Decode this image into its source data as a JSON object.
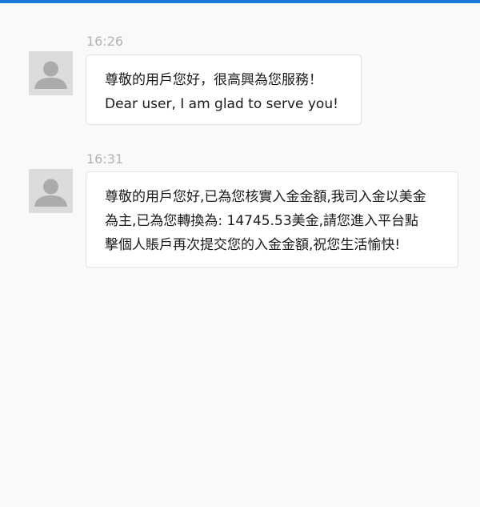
{
  "accent_color": "#1a7bd6",
  "messages": [
    {
      "time": "16:26",
      "avatar_icon": "user-silhouette-icon",
      "lines": [
        "尊敬的用戶您好，很高興為您服務！",
        "Dear user, I am glad to serve you!"
      ]
    },
    {
      "time": "16:31",
      "avatar_icon": "user-silhouette-icon",
      "lines": [
        "尊敬的用戶您好,已為您核實入金金額,我司入金以美金",
        "為主,已為您轉換為: 14745.53美金,請您進入平台點",
        "擊個人賬戶再次提交您的入金金額,祝您生活愉快!"
      ]
    }
  ]
}
